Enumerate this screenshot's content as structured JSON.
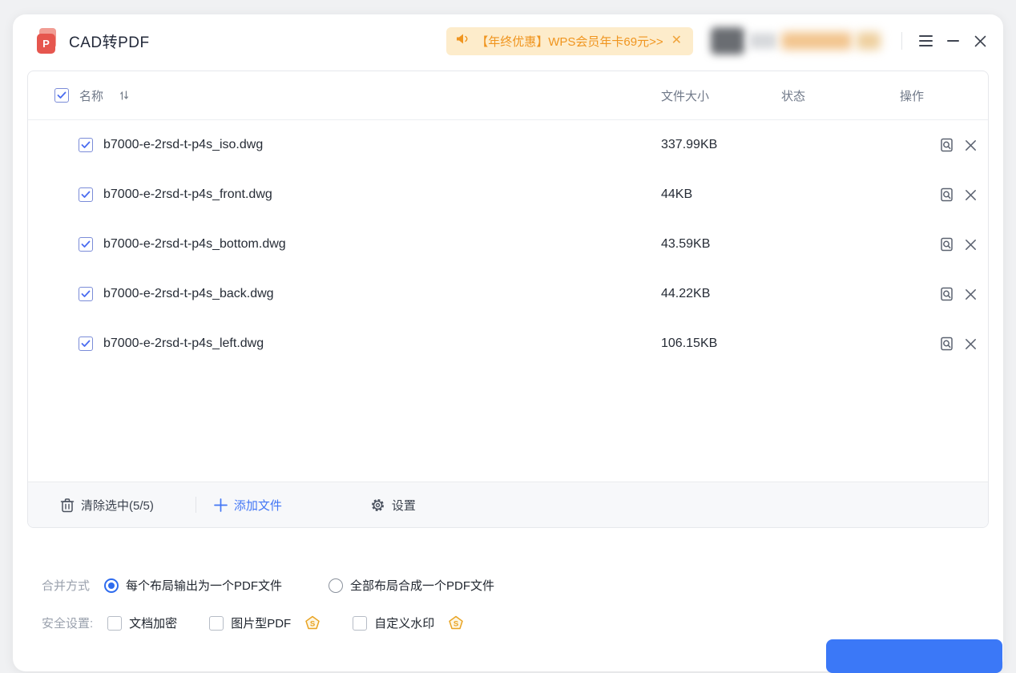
{
  "app": {
    "title": "CAD转PDF",
    "icon_letter": "P"
  },
  "titlebar": {
    "banner": {
      "text": "【年终优惠】WPS会员年卡69元>>",
      "close": "✕"
    }
  },
  "table": {
    "columns": {
      "name": "名称",
      "size": "文件大小",
      "status": "状态",
      "actions": "操作"
    },
    "rows": [
      {
        "name": "b7000-e-2rsd-t-p4s_iso.dwg",
        "size": "337.99KB",
        "status": ""
      },
      {
        "name": "b7000-e-2rsd-t-p4s_front.dwg",
        "size": "44KB",
        "status": ""
      },
      {
        "name": "b7000-e-2rsd-t-p4s_bottom.dwg",
        "size": "43.59KB",
        "status": ""
      },
      {
        "name": "b7000-e-2rsd-t-p4s_back.dwg",
        "size": "44.22KB",
        "status": ""
      },
      {
        "name": "b7000-e-2rsd-t-p4s_left.dwg",
        "size": "106.15KB",
        "status": ""
      }
    ]
  },
  "toolbar": {
    "clear_label": "清除选中(5/5)",
    "add_label": "添加文件",
    "settings_label": "设置"
  },
  "options": {
    "merge_label": "合并方式",
    "merge_options": [
      {
        "label": "每个布局输出为一个PDF文件",
        "selected": true
      },
      {
        "label": "全部布局合成一个PDF文件",
        "selected": false
      }
    ],
    "security_label": "安全设置:",
    "security_options": [
      {
        "label": "文档加密"
      },
      {
        "label": "图片型PDF"
      },
      {
        "label": "自定义水印"
      }
    ],
    "vip_badge_letter": "S"
  },
  "colors": {
    "accent_blue": "#4276f5",
    "radio_blue": "#2e6bee",
    "banner_bg": "#fdeccb",
    "banner_text": "#f0951f",
    "vip_gold": "#e9a322",
    "app_icon_red": "#e6564e",
    "primary_button": "#3b78f7"
  }
}
